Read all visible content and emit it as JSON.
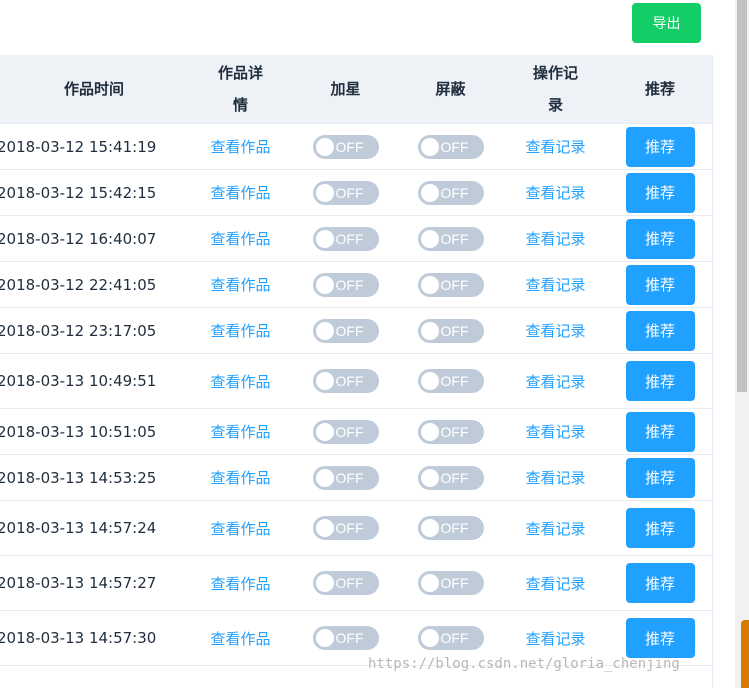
{
  "toolbar": {
    "export_label": "导出"
  },
  "table": {
    "headers": {
      "time": "作品时间",
      "detail_l1": "作品详",
      "detail_l2": "情",
      "star": "加星",
      "block": "屏蔽",
      "log_l1": "操作记",
      "log_l2": "录",
      "recommend": "推荐"
    },
    "rows": [
      {
        "time": "2018-03-12 15:41:19",
        "view": "查看作品",
        "star": "OFF",
        "block": "OFF",
        "log": "查看记录",
        "recommend": "推荐"
      },
      {
        "time": "2018-03-12 15:42:15",
        "view": "查看作品",
        "star": "OFF",
        "block": "OFF",
        "log": "查看记录",
        "recommend": "推荐"
      },
      {
        "time": "2018-03-12 16:40:07",
        "view": "查看作品",
        "star": "OFF",
        "block": "OFF",
        "log": "查看记录",
        "recommend": "推荐"
      },
      {
        "time": "2018-03-12 22:41:05",
        "view": "查看作品",
        "star": "OFF",
        "block": "OFF",
        "log": "查看记录",
        "recommend": "推荐"
      },
      {
        "time": "2018-03-12 23:17:05",
        "view": "查看作品",
        "star": "OFF",
        "block": "OFF",
        "log": "查看记录",
        "recommend": "推荐"
      },
      {
        "time": "2018-03-13 10:49:51",
        "view": "查看作品",
        "star": "OFF",
        "block": "OFF",
        "log": "查看记录",
        "recommend": "推荐"
      },
      {
        "time": "2018-03-13 10:51:05",
        "view": "查看作品",
        "star": "OFF",
        "block": "OFF",
        "log": "查看记录",
        "recommend": "推荐"
      },
      {
        "time": "2018-03-13 14:53:25",
        "view": "查看作品",
        "star": "OFF",
        "block": "OFF",
        "log": "查看记录",
        "recommend": "推荐"
      },
      {
        "time": "2018-03-13 14:57:24",
        "view": "查看作品",
        "star": "OFF",
        "block": "OFF",
        "log": "查看记录",
        "recommend": "推荐"
      },
      {
        "time": "2018-03-13 14:57:27",
        "view": "查看作品",
        "star": "OFF",
        "block": "OFF",
        "log": "查看记录",
        "recommend": "推荐"
      },
      {
        "time": "2018-03-13 14:57:30",
        "view": "查看作品",
        "star": "OFF",
        "block": "OFF",
        "log": "查看记录",
        "recommend": "推荐"
      }
    ]
  },
  "watermark": "https://blog.csdn.net/gloria_chenjing",
  "colors": {
    "export_button": "#13ce66",
    "recommend_button": "#20a0ff",
    "link": "#20a0ff",
    "switch_off": "#bfcbd9",
    "header_bg": "#eef1f6"
  }
}
